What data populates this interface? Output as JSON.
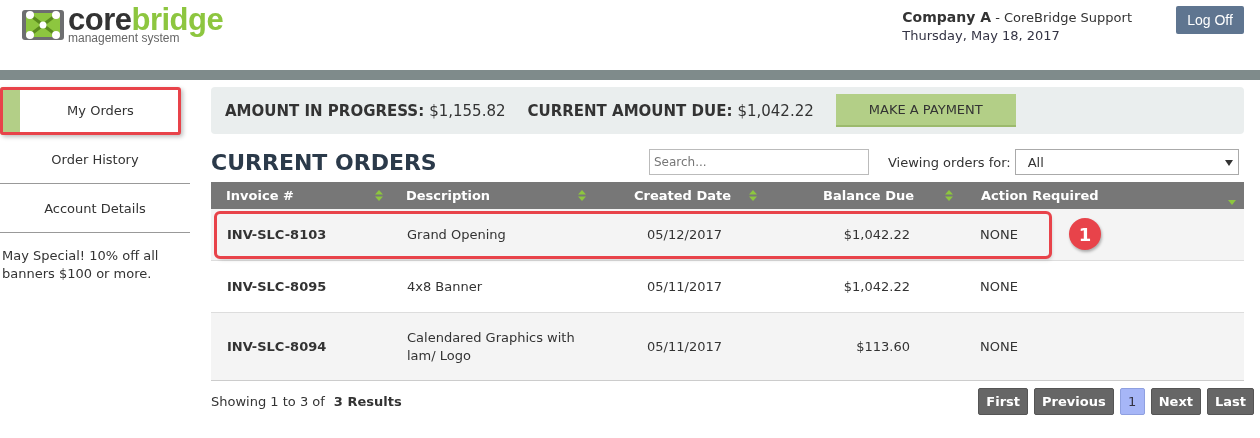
{
  "header": {
    "logo_word_dark": "core",
    "logo_word_green": "bridge",
    "logo_tagline": "management system",
    "company": "Company A",
    "support": "- CoreBridge Support",
    "date": "Thursday, May 18, 2017",
    "logoff": "Log Off"
  },
  "sidebar": {
    "items": [
      {
        "label": "My Orders",
        "selected": true,
        "highlighted": true
      },
      {
        "label": "Order History",
        "selected": false,
        "highlighted": false
      },
      {
        "label": "Account Details",
        "selected": false,
        "highlighted": false
      }
    ],
    "promo": "May Special! 10% off all banners $100 or more."
  },
  "summary": {
    "in_progress_label": "AMOUNT IN PROGRESS:",
    "in_progress_value": "$1,155.82",
    "due_label": "CURRENT AMOUNT DUE:",
    "due_value": "$1,042.22",
    "pay_button": "MAKE A PAYMENT"
  },
  "orders": {
    "title": "CURRENT ORDERS",
    "search_placeholder": "Search...",
    "viewing_label": "Viewing orders for:",
    "viewing_value": "All",
    "columns": [
      {
        "label": "Invoice #",
        "kind": "sortable"
      },
      {
        "label": "Description",
        "kind": "sortable"
      },
      {
        "label": "Created Date",
        "kind": "sortable"
      },
      {
        "label": "Balance Due",
        "kind": "sortable"
      },
      {
        "label": "Action Required",
        "kind": "sorted"
      }
    ],
    "rows": [
      {
        "cells": [
          "INV-SLC-8103",
          "Grand Opening",
          "05/12/2017",
          "$1,042.22",
          "NONE"
        ],
        "highlighted": true,
        "callout": "1"
      },
      {
        "cells": [
          "INV-SLC-8095",
          "4x8 Banner",
          "05/11/2017",
          "$1,042.22",
          "NONE"
        ],
        "highlighted": false
      },
      {
        "cells": [
          "INV-SLC-8094",
          "Calendared Graphics with lam/ Logo",
          "05/11/2017",
          "$113.60",
          "NONE"
        ],
        "highlighted": false
      }
    ],
    "showing": "Showing 1 to 3 of",
    "results": "3 Results",
    "pagination": [
      {
        "label": "First",
        "selected": false
      },
      {
        "label": "Previous",
        "selected": false
      },
      {
        "label": "1",
        "selected": true
      },
      {
        "label": "Next",
        "selected": false
      },
      {
        "label": "Last",
        "selected": false
      }
    ]
  }
}
